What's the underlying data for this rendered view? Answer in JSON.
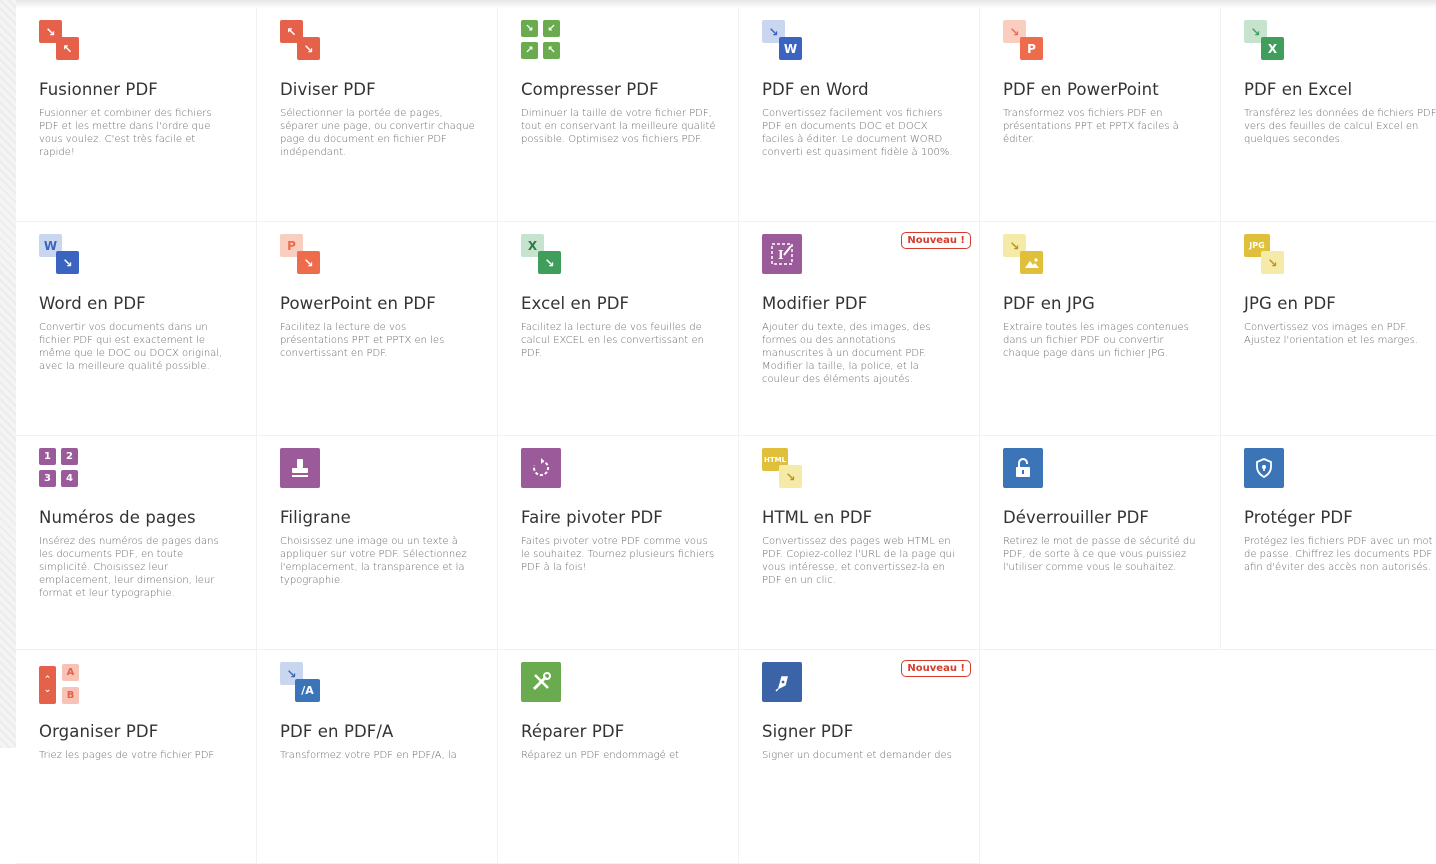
{
  "tools": [
    {
      "title": "Fusionner PDF",
      "desc": "Fusionner et combiner des fichiers PDF et les mettre dans l'ordre que vous voulez. C'est très facile et rapide!",
      "icon": "merge-pdf-icon"
    },
    {
      "title": "Diviser PDF",
      "desc": "Sélectionner la portée de pages, séparer une page, ou convertir chaque page du document en fichier PDF indépendant.",
      "icon": "split-pdf-icon"
    },
    {
      "title": "Compresser PDF",
      "desc": "Diminuer la taille de votre fichier PDF, tout en conservant la meilleure qualité possible. Optimisez vos fichiers PDF.",
      "icon": "compress-pdf-icon"
    },
    {
      "title": "PDF en Word",
      "desc": "Convertissez facilement vos fichiers PDF en documents DOC et DOCX faciles à éditer. Le document WORD converti est quasiment fidèle à 100%.",
      "icon": "pdf-to-word-icon"
    },
    {
      "title": "PDF en PowerPoint",
      "desc": "Transformez vos fichiers PDF en présentations PPT et PPTX faciles à éditer.",
      "icon": "pdf-to-powerpoint-icon"
    },
    {
      "title": "PDF en Excel",
      "desc": "Transférez les données de fichiers PDF vers des feuilles de calcul Excel en quelques secondes.",
      "icon": "pdf-to-excel-icon"
    },
    {
      "title": "Word en PDF",
      "desc": "Convertir vos documents dans un fichier PDF qui est exactement le même que le DOC ou DOCX original, avec la meilleure qualité possible.",
      "icon": "word-to-pdf-icon"
    },
    {
      "title": "PowerPoint en PDF",
      "desc": "Facilitez la lecture de vos présentations PPT et PPTX en les convertissant en PDF.",
      "icon": "powerpoint-to-pdf-icon"
    },
    {
      "title": "Excel en PDF",
      "desc": "Facilitez la lecture de vos feuilles de calcul EXCEL en les convertissant en PDF.",
      "icon": "excel-to-pdf-icon"
    },
    {
      "title": "Modifier PDF",
      "desc": "Ajouter du texte, des images, des formes ou des annotations manuscrites à un document PDF. Modifier la taille, la police, et la couleur des éléments ajoutés.",
      "icon": "edit-pdf-icon",
      "badge": "Nouveau !"
    },
    {
      "title": "PDF en JPG",
      "desc": "Extraire toutes les images contenues dans un fichier PDF ou convertir chaque page dans un fichier JPG.",
      "icon": "pdf-to-jpg-icon"
    },
    {
      "title": "JPG en PDF",
      "desc": "Convertissez vos images en PDF. Ajustez l'orientation et les marges.",
      "icon": "jpg-to-pdf-icon"
    },
    {
      "title": "Numéros de pages",
      "desc": "Insérez des numéros de pages dans les documents PDF, en toute simplicité. Choisissez leur emplacement, leur dimension, leur format et leur typographie.",
      "icon": "page-numbers-icon"
    },
    {
      "title": "Filigrane",
      "desc": "Choisissez une image ou un texte à appliquer sur votre PDF. Sélectionnez l'emplacement, la transparence et la typographie.",
      "icon": "watermark-stamp-icon"
    },
    {
      "title": "Faire pivoter PDF",
      "desc": "Faites pivoter votre PDF comme vous le souhaitez. Tournez plusieurs fichiers PDF à la fois!",
      "icon": "rotate-pdf-icon"
    },
    {
      "title": "HTML en PDF",
      "desc": "Convertissez des pages web HTML en PDF. Copiez-collez l'URL de la page qui vous intéresse, et convertissez-la en PDF en un clic.",
      "icon": "html-to-pdf-icon"
    },
    {
      "title": "Déverrouiller PDF",
      "desc": "Retirez le mot de passe de sécurité du PDF, de sorte à ce que vous puissiez l'utiliser comme vous le souhaitez.",
      "icon": "unlock-padlock-icon"
    },
    {
      "title": "Protéger PDF",
      "desc": "Protégez les fichiers PDF avec un mot de passe. Chiffrez les documents PDF afin d'éviter des accès non autorisés.",
      "icon": "protect-shield-icon"
    },
    {
      "title": "Organiser PDF",
      "desc": "Triez les pages de votre fichier PDF",
      "icon": "organize-pdf-icon"
    },
    {
      "title": "PDF en PDF/A",
      "desc": "Transformez votre PDF en PDF/A, la",
      "icon": "pdf-to-pdfa-icon"
    },
    {
      "title": "Réparer PDF",
      "desc": "Réparez un PDF endommagé et",
      "icon": "repair-tools-icon"
    },
    {
      "title": "Signer PDF",
      "desc": "Signer un document et demander des",
      "icon": "sign-pen-icon",
      "badge": "Nouveau !"
    }
  ],
  "icon_glyphs": {
    "word": "W",
    "powerpoint": "P",
    "excel": "X",
    "jpg": "JPG",
    "html": "HTML",
    "pdfa": "/A",
    "num1": "1",
    "num2": "2",
    "num3": "3",
    "num4": "4",
    "org_a": "A",
    "org_b": "B"
  },
  "colors": {
    "merge": "#e5614a",
    "compress": "#6bab4f",
    "word": "#3b64c1",
    "powerpoint": "#ee6c4c",
    "excel": "#409e5c",
    "edit": "#9b5a9a",
    "jpg": "#e0c03a",
    "numbers": "#9b5a9a",
    "stamp": "#9b5a9a",
    "lock": "#3b75b8",
    "repair": "#6bab4f",
    "badge": "#d63c2b"
  }
}
